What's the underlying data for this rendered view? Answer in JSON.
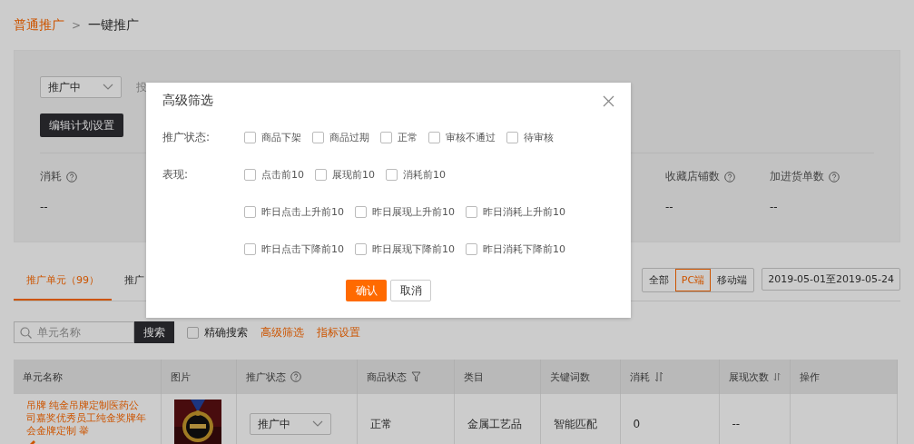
{
  "breadcrumb": [
    {
      "label": "普通推广",
      "kind": "link"
    },
    {
      "label": ">",
      "kind": "separator"
    },
    {
      "label": "一键推广",
      "kind": "current"
    }
  ],
  "plan": {
    "status_select": "推广中",
    "hidden_label": "投",
    "edit_button": "编辑计划设置"
  },
  "stats_left": [
    {
      "label": "消耗",
      "value": "--"
    }
  ],
  "stats_right": [
    {
      "label": "收藏店铺数",
      "value": "--"
    },
    {
      "label": "加进货单数",
      "value": "--"
    }
  ],
  "tabs": [
    {
      "label": "推广单元（99）",
      "selected": true
    },
    {
      "label": "推广",
      "selected": false
    }
  ],
  "devices": [
    {
      "label": "全部",
      "selected": false
    },
    {
      "label": "PC端",
      "selected": true
    },
    {
      "label": "移动端",
      "selected": false
    }
  ],
  "date_range": "2019-05-01至2019-05-24",
  "search": {
    "placeholder": "单元名称",
    "button": "搜索",
    "exact": {
      "label": "精确搜索",
      "checked": false
    },
    "links": [
      "高级筛选",
      "指标设置"
    ]
  },
  "table": {
    "columns": [
      {
        "label": "单元名称",
        "kind": "plain"
      },
      {
        "label": "图片",
        "kind": "plain"
      },
      {
        "label": "推广状态",
        "kind": "help"
      },
      {
        "label": "商品状态",
        "kind": "filter"
      },
      {
        "label": "类目",
        "kind": "plain"
      },
      {
        "label": "关键词数",
        "kind": "plain"
      },
      {
        "label": "消耗",
        "kind": "sortable"
      },
      {
        "label": "展现次数",
        "kind": "sortable"
      },
      {
        "label": "操作",
        "kind": "plain"
      }
    ],
    "rows": [
      {
        "name": "吊牌 纯金吊牌定制医药公司嘉奖优秀员工纯金奖牌年会金牌定制 举",
        "status": "推广中",
        "product_status": "正常",
        "category": "金属工艺品",
        "keywords": "智能匹配",
        "cost": "0",
        "impressions": "--"
      }
    ]
  },
  "modal": {
    "title": "高级筛选",
    "filters": [
      {
        "label": "推广状态:",
        "lines": [
          [
            {
              "label": "商品下架",
              "checked": false
            },
            {
              "label": "商品过期",
              "checked": false
            },
            {
              "label": "正常",
              "checked": false
            },
            {
              "label": "审核不通过",
              "checked": false
            },
            {
              "label": "待审核",
              "checked": false
            }
          ]
        ]
      },
      {
        "label": "表现:",
        "lines": [
          [
            {
              "label": "点击前10",
              "checked": false
            },
            {
              "label": "展现前10",
              "checked": false
            },
            {
              "label": "消耗前10",
              "checked": false
            }
          ],
          [
            {
              "label": "昨日点击上升前10",
              "checked": false
            },
            {
              "label": "昨日展现上升前10",
              "checked": false
            },
            {
              "label": "昨日消耗上升前10",
              "checked": false
            }
          ],
          [
            {
              "label": "昨日点击下降前10",
              "checked": false
            },
            {
              "label": "昨日展现下降前10",
              "checked": false
            },
            {
              "label": "昨日消耗下降前10",
              "checked": false
            }
          ]
        ]
      }
    ],
    "confirm": "确认",
    "cancel": "取消"
  }
}
